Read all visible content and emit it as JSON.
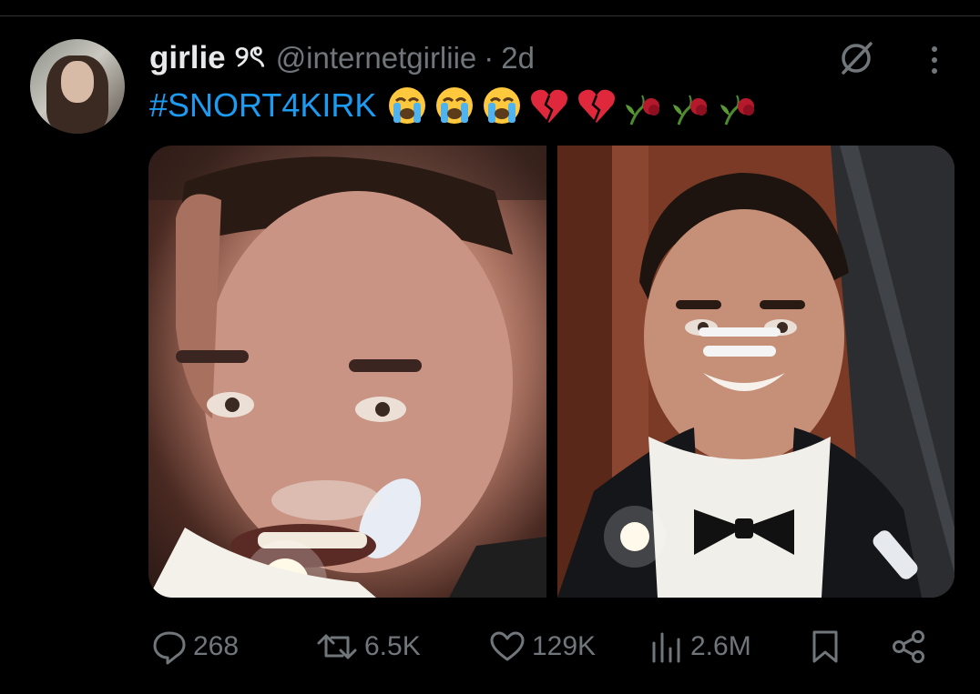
{
  "tweet": {
    "display_name": "girlie",
    "name_decoration": "୨ৎ",
    "handle": "@internetgirliie",
    "separator": "·",
    "time": "2d",
    "hashtag": "#SNORT4KIRK",
    "emojis": [
      "loudly-crying-face",
      "loudly-crying-face",
      "loudly-crying-face",
      "broken-heart",
      "broken-heart",
      "wilted-flower",
      "wilted-flower",
      "wilted-flower"
    ]
  },
  "metrics": {
    "replies": "268",
    "reposts": "6.5K",
    "likes": "129K",
    "views": "2.6M"
  },
  "colors": {
    "background": "#000000",
    "text": "#e7e9ea",
    "muted": "#71767b",
    "link": "#1d9bf0",
    "divider": "#2f3336"
  },
  "icons": {
    "grok": "grok-icon",
    "more": "more-icon",
    "reply": "reply-icon",
    "repost": "repost-icon",
    "like": "heart-icon",
    "views": "views-chart-icon",
    "bookmark": "bookmark-icon",
    "share": "share-icon"
  }
}
